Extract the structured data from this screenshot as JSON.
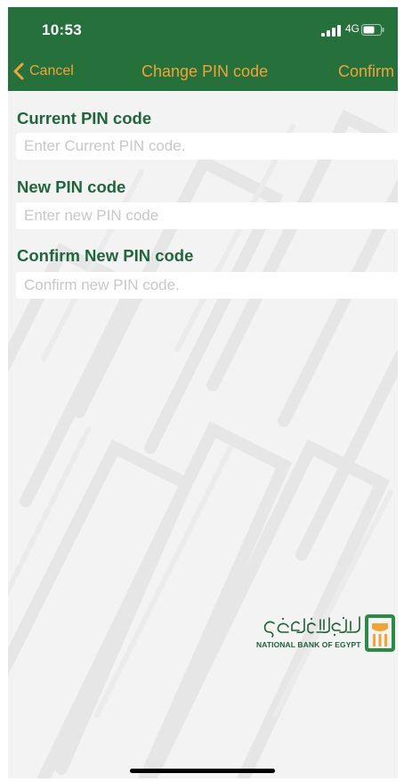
{
  "status_bar": {
    "time": "10:53",
    "network": "4G",
    "signal_icon": "signal-bars-icon",
    "battery_icon": "battery-icon"
  },
  "navbar": {
    "back_icon": "chevron-left-icon",
    "cancel_label": "Cancel",
    "title": "Change PIN code",
    "confirm_label": "Confirm"
  },
  "form": {
    "fields": [
      {
        "label": "Current PIN code",
        "placeholder": "Enter Current PIN code.",
        "value": ""
      },
      {
        "label": "New PIN code",
        "placeholder": "Enter new PIN code",
        "value": ""
      },
      {
        "label": "Confirm New PIN code",
        "placeholder": "Confirm new PIN code.",
        "value": ""
      }
    ]
  },
  "logo": {
    "english_name": "NATIONAL BANK OF EGYPT",
    "arabic_name": "البنك الأهلي المصري",
    "mark_icon": "bank-logo-icon"
  },
  "colors": {
    "header_green": "#26703b",
    "accent_orange": "#f0a43a",
    "label_green": "#20663a",
    "background": "#f3f3f3"
  }
}
